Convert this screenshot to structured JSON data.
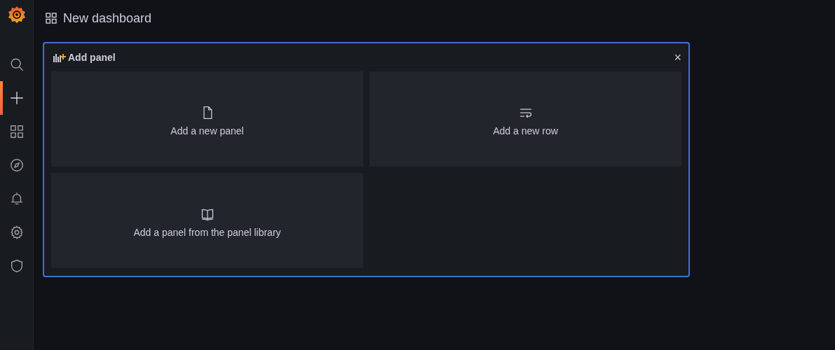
{
  "sidebar": {
    "items": [
      {
        "kind": "search",
        "selected": false
      },
      {
        "kind": "plus",
        "selected": true
      },
      {
        "kind": "grid",
        "selected": false
      },
      {
        "kind": "compass",
        "selected": false
      },
      {
        "kind": "bell",
        "selected": false
      },
      {
        "kind": "gear",
        "selected": false
      },
      {
        "kind": "shield",
        "selected": false
      }
    ]
  },
  "header": {
    "title": "New dashboard"
  },
  "add_panel": {
    "title": "Add panel",
    "close": "×",
    "options": [
      {
        "kind": "file",
        "label": "Add a new panel"
      },
      {
        "kind": "row",
        "label": "Add a new row"
      },
      {
        "kind": "book",
        "label": "Add a panel from the panel library"
      }
    ]
  }
}
